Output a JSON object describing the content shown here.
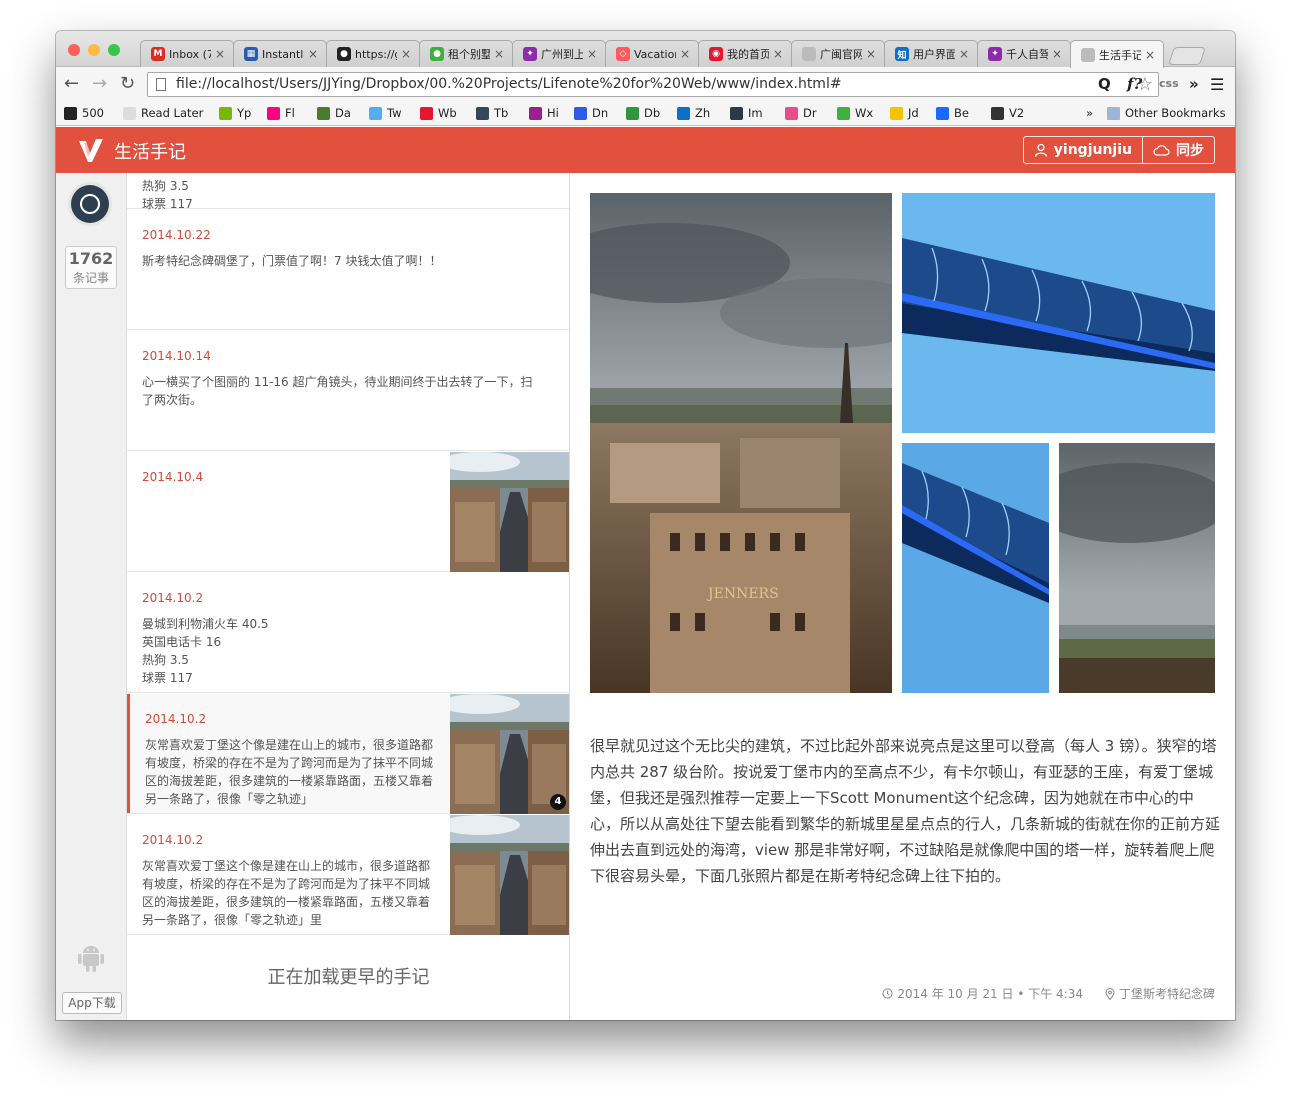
{
  "browser": {
    "tabs": [
      {
        "title": "Inbox (7",
        "icon": "gmail-icon",
        "color": "#d93025",
        "glyph": "M"
      },
      {
        "title": "Instantly",
        "icon": "grid-icon",
        "color": "#2a5db0",
        "glyph": "▦"
      },
      {
        "title": "https://g",
        "icon": "github-icon",
        "color": "#222",
        "glyph": "●"
      },
      {
        "title": "租个别墅",
        "icon": "wechat-icon",
        "color": "#3eb13c",
        "glyph": "●"
      },
      {
        "title": "广州到上",
        "icon": "bookmark-icon",
        "color": "#8e2ba8",
        "glyph": "✦"
      },
      {
        "title": "Vacation",
        "icon": "airbnb-icon",
        "color": "#ff5a5f",
        "glyph": "◇"
      },
      {
        "title": "我的首页",
        "icon": "weibo-icon",
        "color": "#e6162d",
        "glyph": "◉"
      },
      {
        "title": "广闽官网",
        "icon": "page-icon",
        "color": "#bbb",
        "glyph": ""
      },
      {
        "title": "用户界面",
        "icon": "zhihu-icon",
        "color": "#0f6ec7",
        "glyph": "知"
      },
      {
        "title": "千人自驾",
        "icon": "bookmark-icon",
        "color": "#8e2ba8",
        "glyph": "✦"
      },
      {
        "title": "生活手记",
        "icon": "page-icon",
        "color": "#bbb",
        "glyph": ""
      }
    ],
    "url": "file://localhost/Users/JJYing/Dropbox/00.%20Projects/Lifenote%20for%20Web/www/index.html#",
    "extensions": [
      "Q",
      "f?",
      "css",
      "»",
      "☰"
    ],
    "bookmarks": [
      {
        "label": "500",
        "icon": "infinity-icon",
        "color": "#222"
      },
      {
        "label": "Read Later",
        "icon": "page-icon",
        "color": "#ddd"
      },
      {
        "label": "Yp",
        "icon": "yp-icon",
        "color": "#7ab800"
      },
      {
        "label": "Fl",
        "icon": "flickr-icon",
        "color": "#ff0084"
      },
      {
        "label": "Da",
        "icon": "da-icon",
        "color": "#4a7c2e"
      },
      {
        "label": "Tw",
        "icon": "twitter-icon",
        "color": "#55acee"
      },
      {
        "label": "Wb",
        "icon": "weibo-icon",
        "color": "#e6162d"
      },
      {
        "label": "Tb",
        "icon": "tumblr-icon",
        "color": "#35465c"
      },
      {
        "label": "Hi",
        "icon": "hi-icon",
        "color": "#9b1f8e"
      },
      {
        "label": "Dn",
        "icon": "dn-icon",
        "color": "#2d5be3"
      },
      {
        "label": "Db",
        "icon": "douban-icon",
        "color": "#2e963d"
      },
      {
        "label": "Zh",
        "icon": "zhihu-icon",
        "color": "#0f6ec7"
      },
      {
        "label": "Im",
        "icon": "im-icon",
        "color": "#2a3a4a"
      },
      {
        "label": "Dr",
        "icon": "dribbble-icon",
        "color": "#ea4c89"
      },
      {
        "label": "Wx",
        "icon": "wechat-icon",
        "color": "#3eb13c"
      },
      {
        "label": "Jd",
        "icon": "jd-icon",
        "color": "#f5c400"
      },
      {
        "label": "Be",
        "icon": "behance-icon",
        "color": "#1769ff"
      },
      {
        "label": "V2",
        "icon": "v2-icon",
        "color": "#333"
      }
    ],
    "bookmarks_more": "»",
    "other_bookmarks": "Other Bookmarks"
  },
  "app": {
    "accent": "#e2503e",
    "brand": "生活手记",
    "user": "yingjunjiu",
    "sync": "同步",
    "count": "1762",
    "count_label": "条记事",
    "app_download": "App下载",
    "loading_text": "正在加载更早的手记",
    "list": [
      {
        "date": "",
        "text": "热狗 3.5\n球票 117",
        "thumb": false
      },
      {
        "date": "2014.10.22",
        "text": "斯考特纪念碑碉堡了，门票值了啊！7 块钱太值了啊！！",
        "thumb": false
      },
      {
        "date": "2014.10.14",
        "text": "心一横买了个图丽的 11-16 超广角镜头，待业期间终于出去转了一下，扫了两次街。",
        "thumb": false
      },
      {
        "date": "2014.10.4",
        "text": "",
        "thumb": true
      },
      {
        "date": "2014.10.2",
        "text": "曼城到利物浦火车 40.5\n英国电话卡 16\n热狗 3.5\n球票 117",
        "thumb": false
      },
      {
        "date": "2014.10.2",
        "text": "灰常喜欢爱丁堡这个像是建在山上的城市，很多道路都有坡度，桥梁的存在不是为了跨河而是为了抹平不同城区的海拔差距，很多建筑的一楼紧靠路面，五楼又靠着另一条路了，很像「零之轨迹」",
        "thumb": true,
        "badge": "4",
        "selected": true
      },
      {
        "date": "2014.10.2",
        "text": "灰常喜欢爱丁堡这个像是建在山上的城市，很多道路都有坡度，桥梁的存在不是为了跨河而是为了抹平不同城区的海拔差距，很多建筑的一楼紧靠路面，五楼又靠着另一条路了，很像「零之轨迹」里",
        "thumb": true
      }
    ],
    "detail": {
      "photo_sign_text": "JENNERS",
      "text": "很早就见过这个无比尖的建筑，不过比起外部来说亮点是这里可以登高（每人 3 镑）。狭窄的塔内总共 287 级台阶。按说爱丁堡市内的至高点不少，有卡尔顿山，有亚瑟的王座，有爱丁堡城堡，但我还是强烈推荐一定要上一下Scott Monument这个纪念碑，因为她就在市中心的中心，所以从高处往下望去能看到繁华的新城里星星点点的行人，几条新城的街就在你的正前方延伸出去直到远处的海湾，view 那是非常好啊，不过缺陷是就像爬中国的塔一样，旋转着爬上爬下很容易头晕，下面几张照片都是在斯考特纪念碑上往下拍的。",
      "time": "2014 年 10 月 21 日 • 下午 4:34",
      "location": "丁堡斯考特纪念碑"
    }
  }
}
